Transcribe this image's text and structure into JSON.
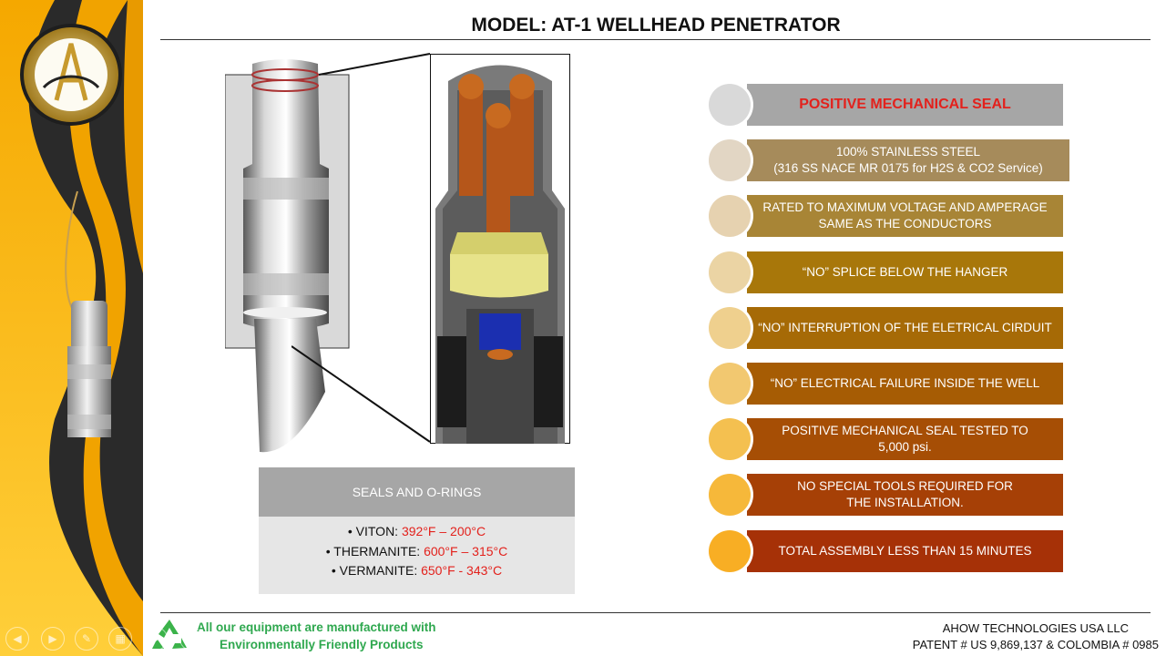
{
  "title": "MODEL: AT-1 WELLHEAD PENETRATOR",
  "seals": {
    "header": "SEALS AND O-RINGS",
    "items": [
      {
        "name": "• VITON: ",
        "value": "392°F – 200°C"
      },
      {
        "name": "• THERMANITE: ",
        "value": "600°F – 315°C"
      },
      {
        "name": "• VERMANITE: ",
        "value": "650°F - 343°C"
      }
    ]
  },
  "features": [
    {
      "text": "POSITIVE MECHANICAL SEAL",
      "band_color": "#a6a6a6",
      "circle_color": "#d9d9d9"
    },
    {
      "text": "100% STAINLESS STEEL\n(316 SS NACE MR 0175 for H2S & CO2 Service)",
      "band_color": "#a68b5b",
      "circle_color": "#e2d6c4"
    },
    {
      "text": "RATED TO MAXIMUM VOLTAGE AND AMPERAGE SAME AS THE CONDUCTORS",
      "band_color": "#a88536",
      "circle_color": "#e6d2b0"
    },
    {
      "text": "“NO” SPLICE BELOW THE HANGER",
      "band_color": "#a8770a",
      "circle_color": "#ebd4a4"
    },
    {
      "text": "“NO” INTERRUPTION OF THE ELETRICAL CIRDUIT",
      "band_color": "#a66a06",
      "circle_color": "#efd08e"
    },
    {
      "text": "“NO” ELECTRICAL FAILURE INSIDE THE WELL",
      "band_color": "#a65c04",
      "circle_color": "#f2c870"
    },
    {
      "text": "POSITIVE MECHANICAL SEAL TESTED TO  5,000 psi.",
      "band_color": "#a64e05",
      "circle_color": "#f4c050"
    },
    {
      "text": "NO SPECIAL TOOLS REQUIRED FOR THE INSTALLATION.",
      "band_color": "#a64006",
      "circle_color": "#f6b83a"
    },
    {
      "text": "TOTAL ASSEMBLY LESS THAN 15 MINUTES",
      "band_color": "#a63107",
      "circle_color": "#f8ae24"
    }
  ],
  "footer": {
    "eco_line1": "All our equipment are manufactured with",
    "eco_line2": "Environmentally Friendly Products",
    "company": "AHOW TECHNOLOGIES  USA LLC",
    "patent": "PATENT # US 9,869,137 & COLOMBIA # 0985"
  },
  "nav_icons": [
    "previous-icon",
    "next-icon",
    "pen-icon",
    "slides-icon",
    "search-icon",
    "more-icon"
  ]
}
